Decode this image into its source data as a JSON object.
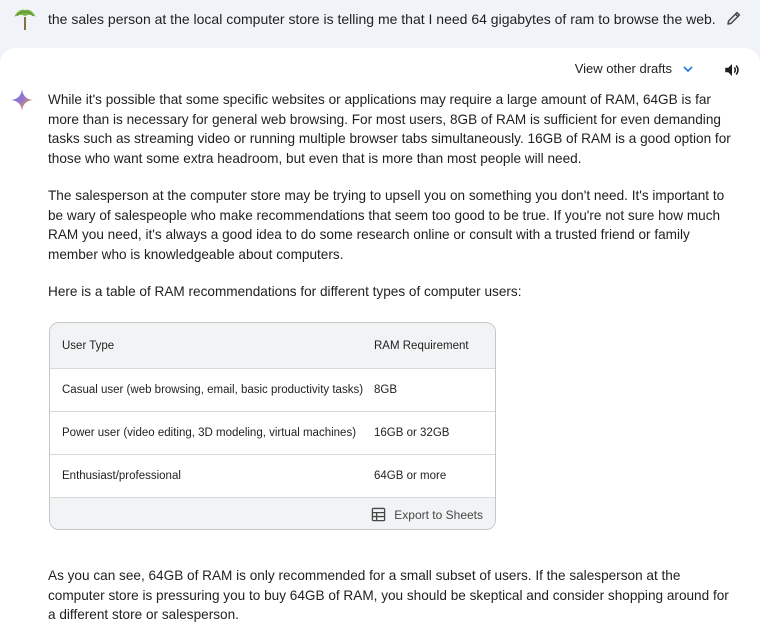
{
  "prompt": {
    "text": "the sales person at the local computer store is telling me that I need 64 gigabytes of ram to browse the web."
  },
  "response": {
    "drafts_label": "View other drafts",
    "paragraphs": [
      "While it's possible that some specific websites or applications may require a large amount of RAM, 64GB is far more than is necessary for general web browsing. For most users, 8GB of RAM is sufficient for even demanding tasks such as streaming video or running multiple browser tabs simultaneously. 16GB of RAM is a good option for those who want some extra headroom, but even that is more than most people will need.",
      "The salesperson at the computer store may be trying to upsell you on something you don't need. It's important to be wary of salespeople who make recommendations that seem too good to be true. If you're not sure how much RAM you need, it's always a good idea to do some research online or consult with a trusted friend or family member who is knowledgeable about computers.",
      "Here is a table of RAM recommendations for different types of computer users:"
    ],
    "table": {
      "headers": [
        "User Type",
        "RAM Requirement"
      ],
      "rows": [
        [
          "Casual user (web browsing, email, basic productivity tasks)",
          "8GB"
        ],
        [
          "Power user (video editing, 3D modeling, virtual machines)",
          "16GB or 32GB"
        ],
        [
          "Enthusiast/professional",
          "64GB or more"
        ]
      ],
      "export_label": "Export to Sheets"
    },
    "closing": "As you can see, 64GB of RAM is only recommended for a small subset of users. If the salesperson at the computer store is pressuring you to buy 64GB of RAM, you should be skeptical and consider shopping around for a different store or salesperson."
  },
  "icons": {
    "avatar": "palm-tree-icon",
    "edit": "pencil-icon",
    "drafts": "chevron-down-icon",
    "speaker": "speaker-icon",
    "sparkle": "sparkle-icon",
    "export": "sheets-icon"
  },
  "colors": {
    "background": "#f0f4f9",
    "card": "#ffffff",
    "accent_blue": "#1a73e8"
  }
}
